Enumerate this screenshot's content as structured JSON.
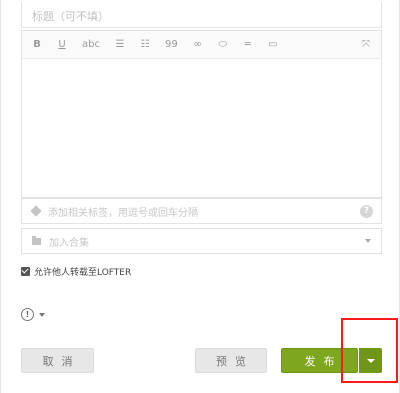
{
  "title_input": {
    "placeholder": "标题（可不填）"
  },
  "toolbar": {
    "bold": "B",
    "underline": "U",
    "strike": "abc",
    "ul": "☰",
    "ol": "☷",
    "quote": "99",
    "link": "∞",
    "media": "⬭",
    "hr": "═",
    "image": "▭",
    "expand": "⤧"
  },
  "tag_field": {
    "placeholder": "添加相关标签，用逗号或回车分隔",
    "help": "?"
  },
  "collection": {
    "placeholder": "加入合集"
  },
  "repost": {
    "label": "允许他人转载至LOFTER",
    "checked": true
  },
  "privacy": {
    "icon": "!"
  },
  "buttons": {
    "cancel": "取消",
    "preview": "预览",
    "publish": "发布"
  },
  "colors": {
    "publish": "#7ea61f",
    "highlight": "#ff1a1a"
  }
}
